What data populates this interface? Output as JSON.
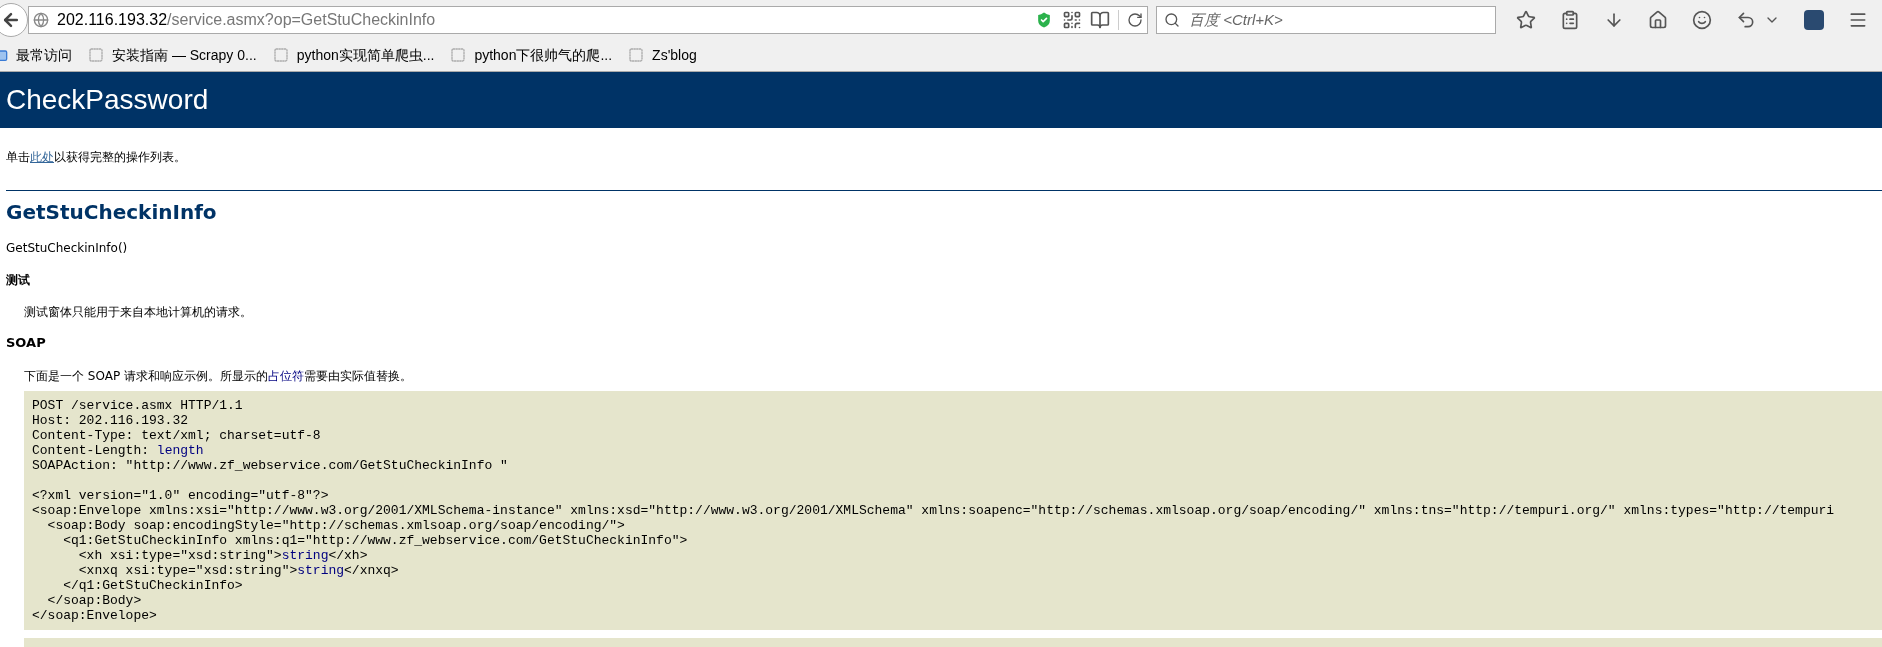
{
  "browser": {
    "url_host": "202.116.193.32",
    "url_path": "/service.asmx?op=GetStuCheckinInfo",
    "search_placeholder": "百度 <Ctrl+K>"
  },
  "bookmarks": [
    {
      "label": "最常访问",
      "kind": "folder"
    },
    {
      "label": "安装指南 — Scrapy 0...",
      "kind": "page"
    },
    {
      "label": "python实现简单爬虫...",
      "kind": "page"
    },
    {
      "label": "python下很帅气的爬...",
      "kind": "page"
    },
    {
      "label": "Zs'blog",
      "kind": "page"
    }
  ],
  "page": {
    "title": "CheckPassword",
    "intro": {
      "before": "单击",
      "link": "此处",
      "after": "以获得完整的操作列表。"
    },
    "operation": {
      "name": "GetStuCheckinInfo",
      "signature": "GetStuCheckinInfo()",
      "test_heading": "测试",
      "test_text": "测试窗体只能用于来自本地计算机的请求。",
      "soap_heading": "SOAP",
      "soap_text": {
        "before": "下面是一个 SOAP 请求和响应示例。所显示的",
        "link": "占位符",
        "after": "需要由实际值替换。"
      },
      "code_lines": [
        {
          "kind": "code",
          "parts": [
            {
              "text": "POST /service.asmx HTTP/1.1",
              "kind": "literal"
            }
          ]
        },
        {
          "kind": "code",
          "parts": [
            {
              "text": "Host: 202.116.193.32",
              "kind": "literal"
            }
          ]
        },
        {
          "kind": "code",
          "parts": [
            {
              "text": "Content-Type: text/xml; charset=utf-8",
              "kind": "literal"
            }
          ]
        },
        {
          "kind": "code",
          "parts": [
            {
              "text": "Content-Length: ",
              "kind": "literal"
            },
            {
              "text": "length",
              "kind": "placeholder"
            }
          ]
        },
        {
          "kind": "code",
          "parts": [
            {
              "text": "SOAPAction: \"http://www.zf_webservice.com/GetStuCheckinInfo \"",
              "kind": "literal"
            }
          ]
        },
        {
          "kind": "blank"
        },
        {
          "kind": "code",
          "parts": [
            {
              "text": "<?xml version=\"1.0\" encoding=\"utf-8\"?>",
              "kind": "literal"
            }
          ]
        },
        {
          "kind": "code",
          "parts": [
            {
              "text": "<soap:Envelope xmlns:xsi=\"http://www.w3.org/2001/XMLSchema-instance\" xmlns:xsd=\"http://www.w3.org/2001/XMLSchema\" xmlns:soapenc=\"http://schemas.xmlsoap.org/soap/encoding/\" xmlns:tns=\"http://tempuri.org/\" xmlns:types=\"http://tempuri",
              "kind": "literal"
            }
          ]
        },
        {
          "kind": "code",
          "parts": [
            {
              "text": "  <soap:Body soap:encodingStyle=\"http://schemas.xmlsoap.org/soap/encoding/\">",
              "kind": "literal"
            }
          ]
        },
        {
          "kind": "code",
          "parts": [
            {
              "text": "    <q1:GetStuCheckinInfo xmlns:q1=\"http://www.zf_webservice.com/GetStuCheckinInfo\">",
              "kind": "literal"
            }
          ]
        },
        {
          "kind": "code",
          "parts": [
            {
              "text": "      <xh xsi:type=\"xsd:string\">",
              "kind": "literal"
            },
            {
              "text": "string",
              "kind": "placeholder"
            },
            {
              "text": "</xh>",
              "kind": "literal"
            }
          ]
        },
        {
          "kind": "code",
          "parts": [
            {
              "text": "      <xnxq xsi:type=\"xsd:string\">",
              "kind": "literal"
            },
            {
              "text": "string",
              "kind": "placeholder"
            },
            {
              "text": "</xnxq>",
              "kind": "literal"
            }
          ]
        },
        {
          "kind": "code",
          "parts": [
            {
              "text": "    </q1:GetStuCheckinInfo>",
              "kind": "literal"
            }
          ]
        },
        {
          "kind": "code",
          "parts": [
            {
              "text": "  </soap:Body>",
              "kind": "literal"
            }
          ]
        },
        {
          "kind": "code",
          "parts": [
            {
              "text": "</soap:Envelope>",
              "kind": "literal"
            }
          ]
        }
      ]
    }
  }
}
